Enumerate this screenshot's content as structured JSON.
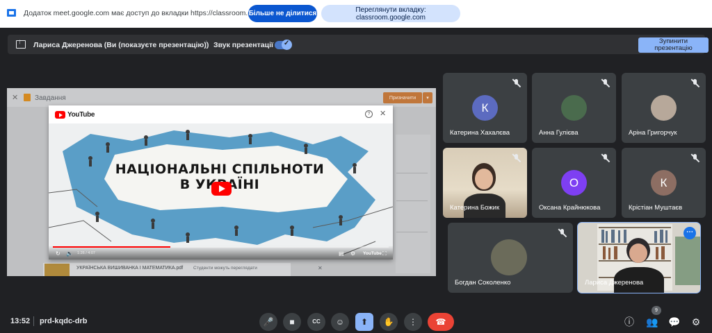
{
  "share_banner": {
    "message": "Додаток meet.google.com має доступ до вкладки https://classroom.google.com",
    "stop_sharing_label": "Більше не ділитися",
    "view_tab_label": "Переглянути вкладку: classroom.google.com"
  },
  "presenting": {
    "presenter_label": "Лариса Джеренова (Ви (показуєте презентацію))",
    "sound_label": "Звук презентації",
    "sound_enabled": true,
    "stop_button_label": "Зупинити презентацію"
  },
  "shared_screen": {
    "window_title": "Завдання",
    "assign_button": "Призначити",
    "attachment_name": "УКРАЇНСЬКА ВИШИВАНКА І МАТЕМАТИКА.pdf",
    "attachment_permission": "Студенти можуть переглядати",
    "youtube": {
      "logo_text": "YouTube",
      "video_headline_line1": "НАЦІОНАЛЬНІ СПІЛЬНОТИ",
      "video_headline_line2": "В УКРАЇНІ",
      "time": "1:26 / 4:07",
      "progress": 0.35,
      "brand": "YouTube"
    }
  },
  "participants": [
    {
      "name": "Катерина Хахалєва",
      "initial": "К",
      "avatar_color": "#5c6bc0",
      "muted": true
    },
    {
      "name": "Анна Гулієва",
      "initial": "",
      "avatar_color": "#4a6b4d",
      "muted": true
    },
    {
      "name": "Аріна Григорчук",
      "initial": "",
      "avatar_color": "#b7a89a",
      "muted": true
    },
    {
      "name": "Катерина Божик",
      "initial": "",
      "avatar_color": "#b48a6a",
      "muted": true
    },
    {
      "name": "Оксана Крайнюкова",
      "initial": "О",
      "avatar_color": "#7e3ff2",
      "muted": true
    },
    {
      "name": "Крістіан Муштаєв",
      "initial": "К",
      "avatar_color": "#8d6e63",
      "muted": true
    },
    {
      "name": "Богдан Соколенко",
      "initial": "",
      "avatar_color": "#6b6b5a",
      "muted": true
    },
    {
      "name": "Лариса Джеренова",
      "initial": "",
      "avatar_color": "#3e4a3c",
      "muted": false
    }
  ],
  "bottom_bar": {
    "time": "13:52",
    "meeting_code": "prd-kqdc-drb",
    "participant_count": "9"
  },
  "colors": {
    "background": "#202124",
    "tile": "#3c4043",
    "accent": "#8ab4f8",
    "hangup": "#ea4335"
  }
}
